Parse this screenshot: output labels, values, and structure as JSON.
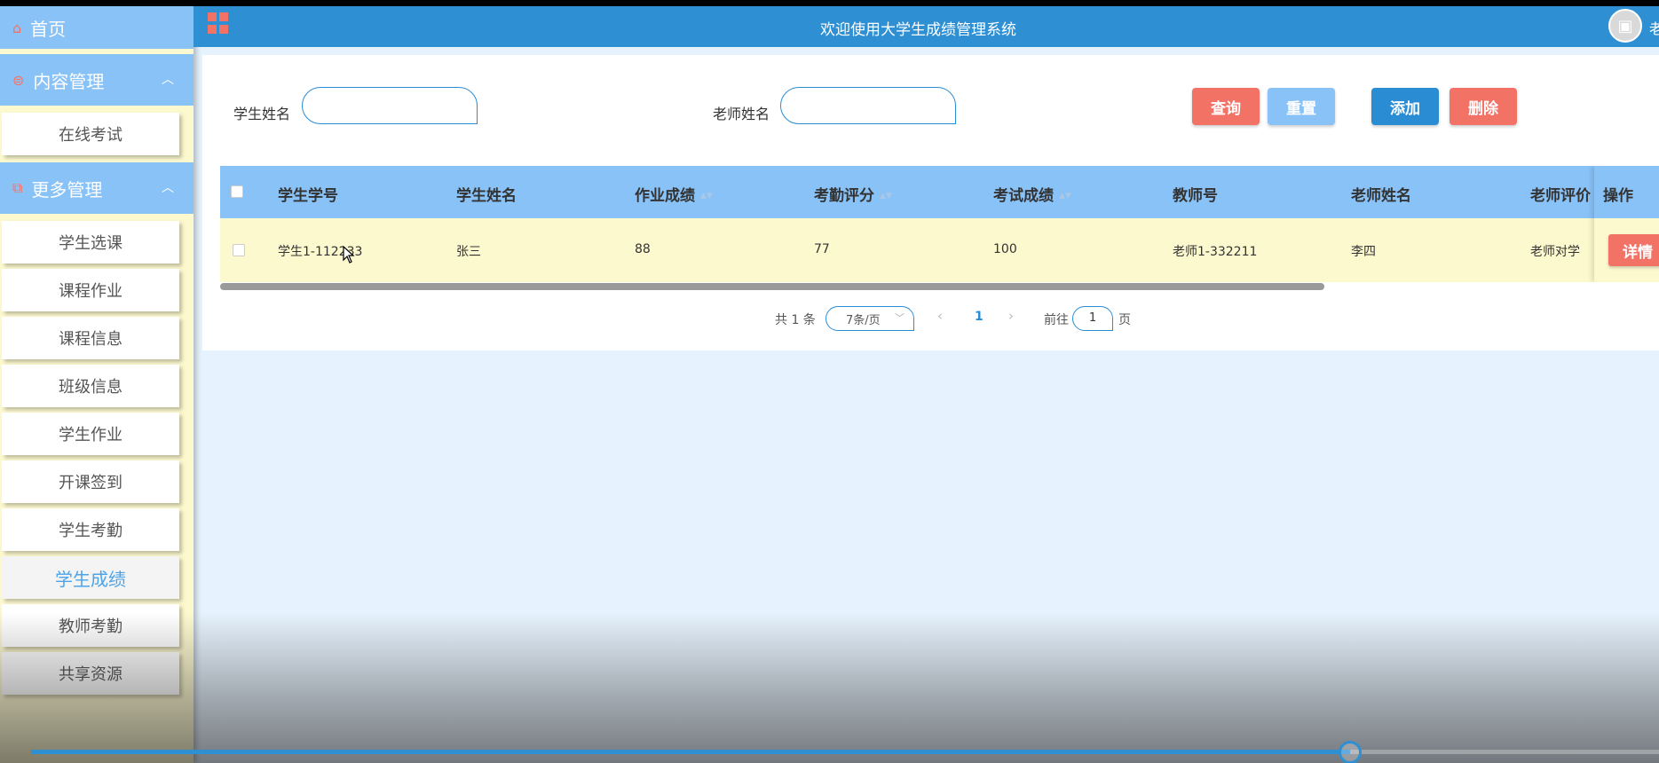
{
  "header": {
    "title": "欢迎使用大学生成绩管理系统",
    "user_partial": "老"
  },
  "sidebar": {
    "home_label": "首页",
    "sections": [
      {
        "label": "内容管理",
        "items": [
          "在线考试"
        ]
      },
      {
        "label": "更多管理",
        "items": [
          "学生选课",
          "课程作业",
          "课程信息",
          "班级信息",
          "学生作业",
          "开课签到",
          "学生考勤",
          "学生成绩",
          "教师考勤",
          "共享资源"
        ]
      }
    ],
    "active_item": "学生成绩"
  },
  "search": {
    "student_name_label": "学生姓名",
    "student_name_value": "",
    "teacher_name_label": "老师姓名",
    "teacher_name_value": ""
  },
  "buttons": {
    "query": "查询",
    "reset": "重置",
    "add": "添加",
    "delete": "删除",
    "detail": "详情"
  },
  "table": {
    "columns": [
      "学生学号",
      "学生姓名",
      "作业成绩",
      "考勤评分",
      "考试成绩",
      "教师号",
      "老师姓名",
      "老师评价",
      "操作"
    ],
    "sortable": [
      "作业成绩",
      "考勤评分",
      "考试成绩"
    ],
    "rows": [
      {
        "student_id": "学生1-112233",
        "student_name": "张三",
        "homework_score": "88",
        "attendance_score": "77",
        "exam_score": "100",
        "teacher_id": "老师1-332211",
        "teacher_name": "李四",
        "teacher_comment": "老师对学"
      }
    ]
  },
  "pagination": {
    "total_text": "共 1 条",
    "page_size": "7条/页",
    "current_page": "1",
    "goto_prefix": "前往",
    "goto_value": "1",
    "goto_suffix": "页"
  },
  "video_progress": {
    "fraction": 0.81
  },
  "colors": {
    "primary": "#2f8fd3",
    "light_blue": "#89c2f7",
    "accent_red": "#f37266",
    "row_yellow": "#fdf9cf"
  }
}
